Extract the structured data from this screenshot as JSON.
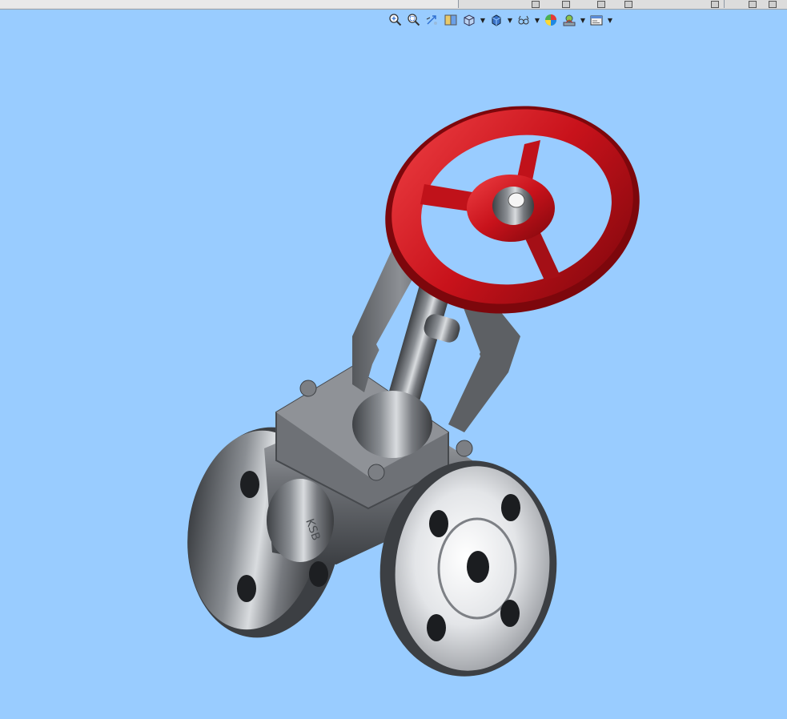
{
  "window": {
    "top_strip_label": ""
  },
  "heads_up_toolbar": {
    "buttons": [
      {
        "icon": "zoom-to-fit-icon"
      },
      {
        "icon": "zoom-to-area-icon"
      },
      {
        "icon": "previous-view-icon"
      },
      {
        "icon": "section-view-icon"
      },
      {
        "icon": "view-orientation-icon",
        "has_dropdown": true
      },
      {
        "icon": "display-style-icon",
        "has_dropdown": true
      },
      {
        "icon": "hide-show-items-icon",
        "has_dropdown": true
      },
      {
        "icon": "edit-appearance-icon"
      },
      {
        "icon": "apply-scene-icon",
        "has_dropdown": true
      },
      {
        "icon": "view-settings-icon",
        "has_dropdown": true
      }
    ]
  },
  "graphics_area": {
    "background_color": "#99ccff",
    "model": {
      "description_visible": false,
      "handwheel_color": "#c0121a",
      "body_color": "#6b6e72",
      "embossed_text": "KSB"
    }
  }
}
